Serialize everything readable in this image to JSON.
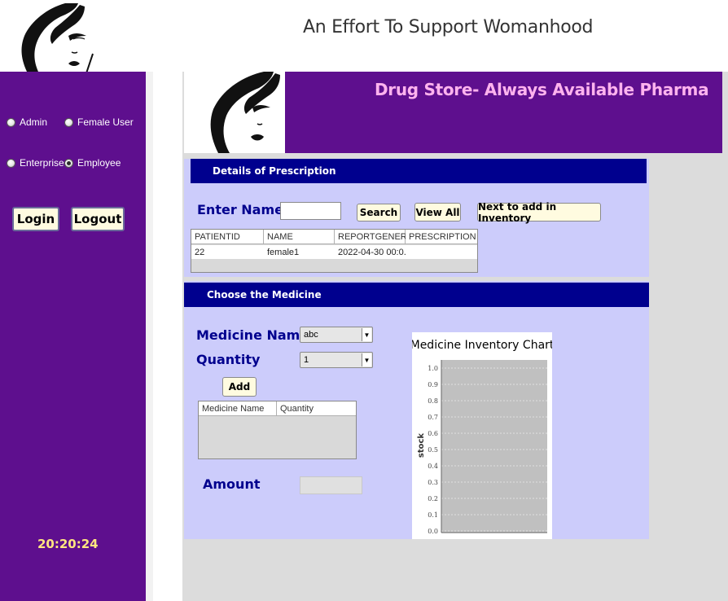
{
  "header": {
    "tagline": "An Effort To Support Womanhood"
  },
  "sidebar": {
    "roles": [
      {
        "label": "Admin",
        "checked": false
      },
      {
        "label": "Female User",
        "checked": false
      },
      {
        "label": "Enterprise",
        "checked": false
      },
      {
        "label": "Employee",
        "checked": true
      }
    ],
    "login_label": "Login",
    "logout_label": "Logout",
    "clock": "20:20:24"
  },
  "store": {
    "title": "Drug Store- Always Available Pharma"
  },
  "prescription": {
    "section_title": "Details of Prescription",
    "enter_name_label": "Enter Name :",
    "name_value": "",
    "search_label": "Search",
    "view_all_label": "View All",
    "next_label": "Next to add in Inventory",
    "columns": [
      "PATIENTID",
      "NAME",
      "REPORTGENER...",
      "PRESCRIPTION"
    ],
    "rows": [
      [
        "22",
        "female1",
        "2022-04-30 00:0...",
        ""
      ]
    ]
  },
  "medicine": {
    "section_title": "Choose the Medicine",
    "name_label": "Medicine Name",
    "name_selected": "abc",
    "quantity_label": "Quantity",
    "quantity_selected": "1",
    "add_label": "Add",
    "columns": [
      "Medicine Name",
      "Quantity"
    ],
    "amount_label": "Amount",
    "amount_value": ""
  },
  "chart_data": {
    "type": "bar",
    "title": "Medicine Inventory Chart",
    "xlabel": "",
    "ylabel": "stock",
    "ylim": [
      0.0,
      1.0
    ],
    "yticks": [
      "1.0",
      "0.9",
      "0.8",
      "0.7",
      "0.6",
      "0.5",
      "0.4",
      "0.3",
      "0.2",
      "0.1",
      "0.0"
    ],
    "categories": [],
    "values": [],
    "grid": true,
    "colors": {
      "plot_bg": "#c0c0c0",
      "grid": "#ffffff"
    }
  }
}
